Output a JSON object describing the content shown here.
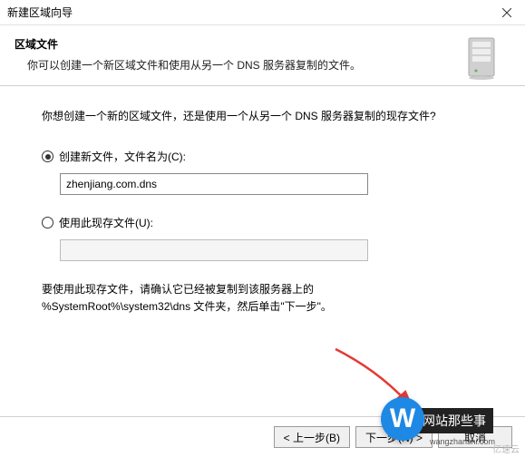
{
  "titlebar": {
    "title": "新建区域向导"
  },
  "header": {
    "title": "区域文件",
    "desc": "你可以创建一个新区域文件和使用从另一个 DNS 服务器复制的文件。"
  },
  "content": {
    "question": "你想创建一个新的区域文件，还是使用一个从另一个 DNS 服务器复制的现存文件?",
    "option_create": "创建新文件，文件名为(C):",
    "create_value": "zhenjiang.com.dns",
    "option_existing": "使用此现存文件(U):",
    "existing_value": "",
    "note_line1": "要使用此现存文件，请确认它已经被复制到该服务器上的",
    "note_line2": "%SystemRoot%\\system32\\dns 文件夹，然后单击\"下一步\"。"
  },
  "footer": {
    "back": "< 上一步(B)",
    "next": "下一步(N) >",
    "cancel": "取消"
  },
  "watermark": {
    "logo_letter": "W",
    "text": "网站那些事",
    "url": "wangzhanshi.com",
    "corner": "亿速云"
  }
}
